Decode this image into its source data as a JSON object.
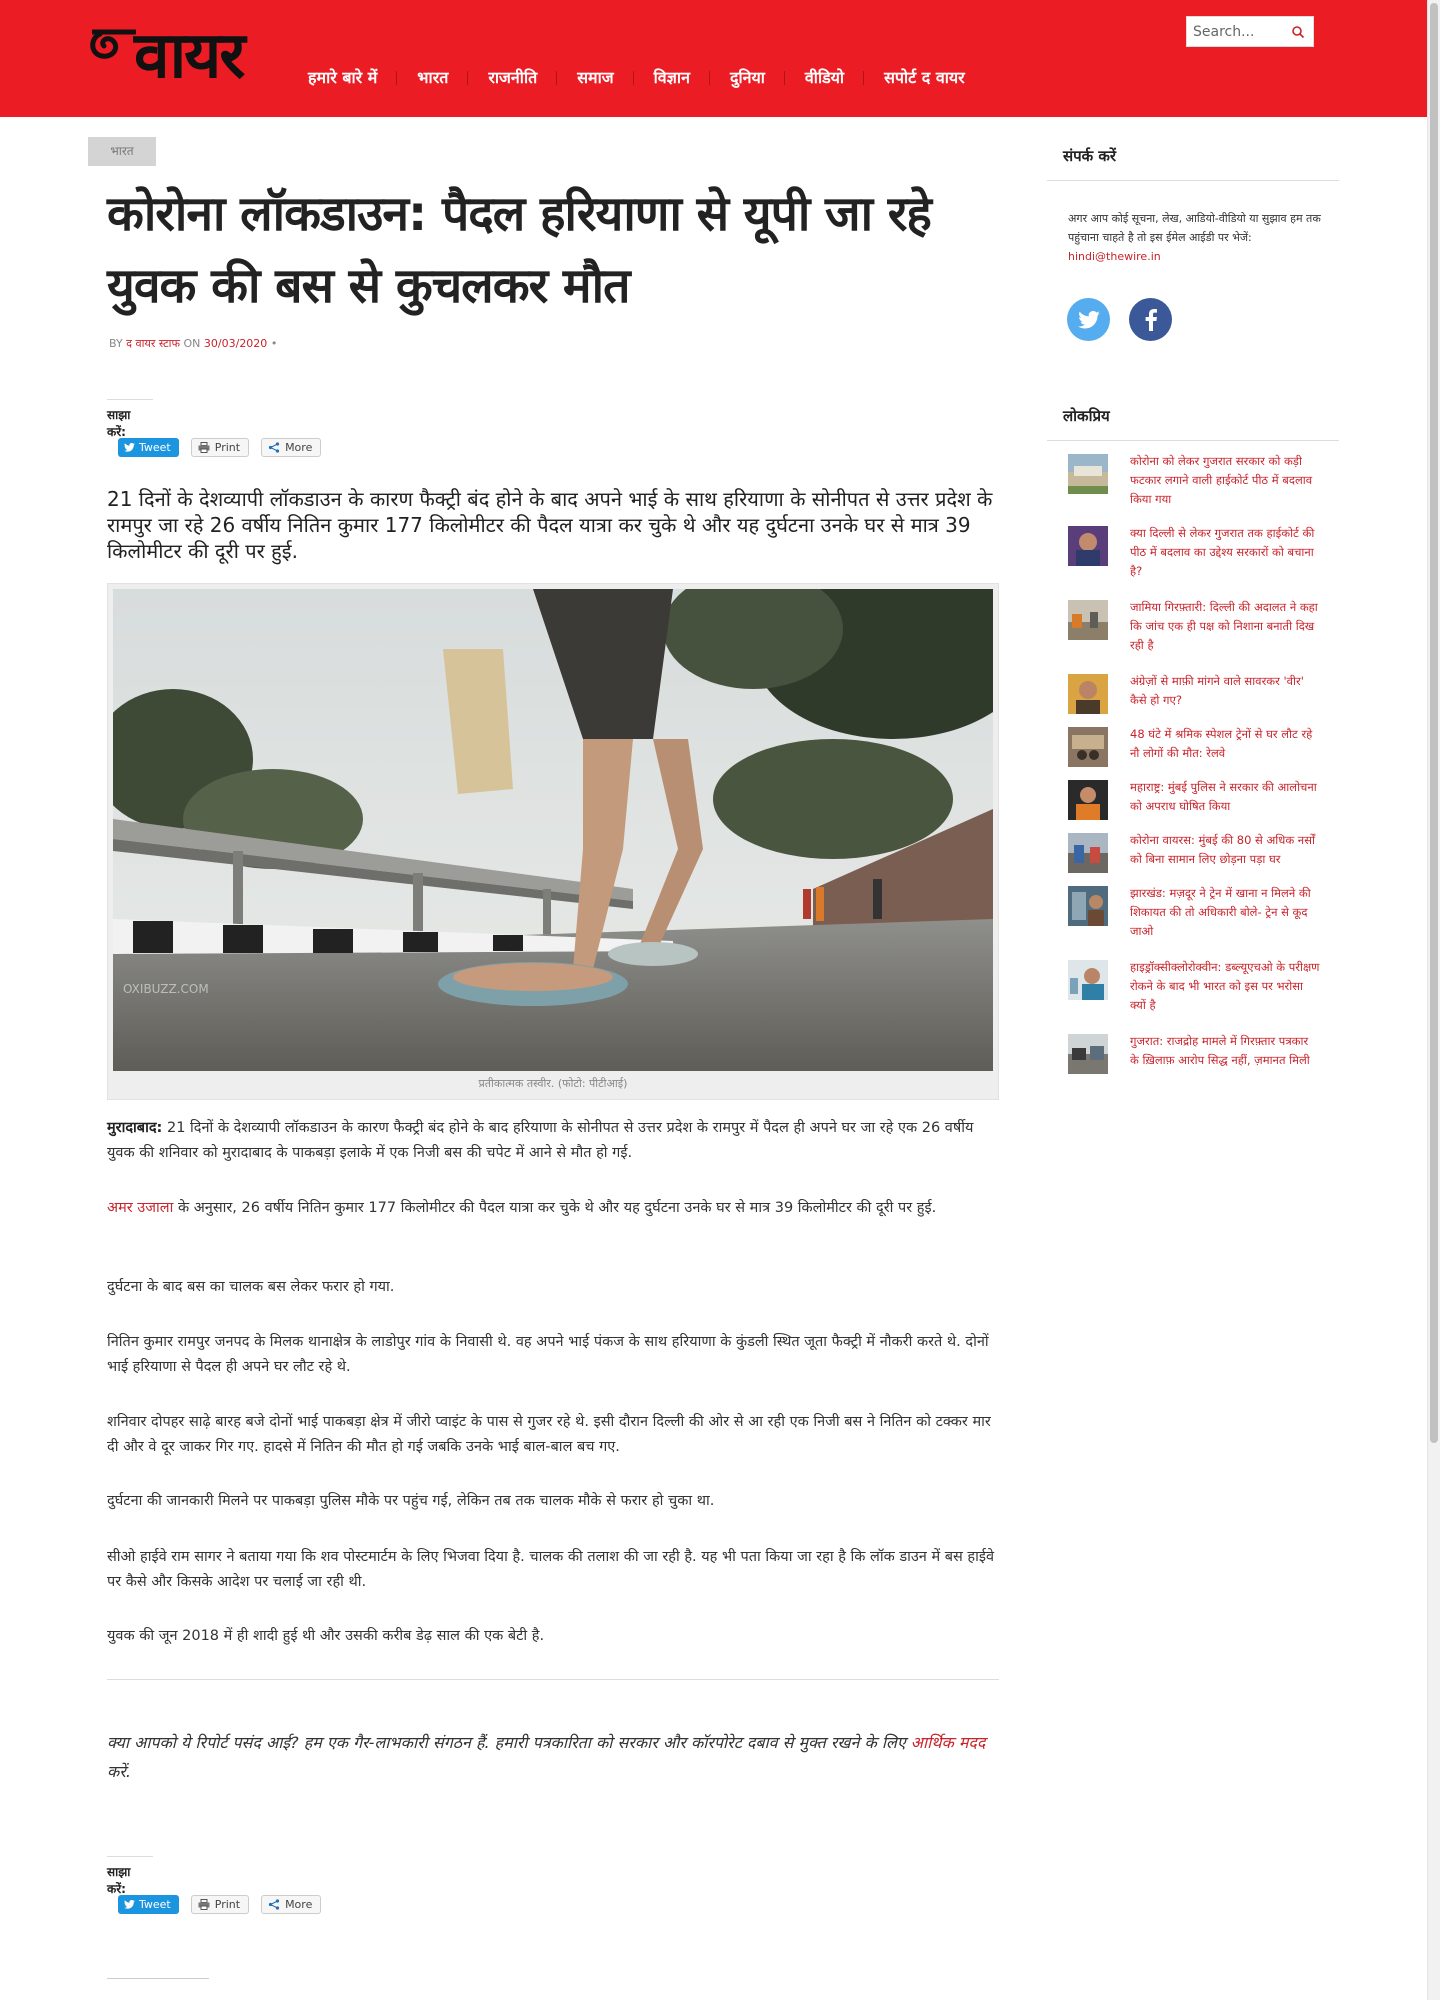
{
  "header": {
    "logo_text": "वायर",
    "nav": [
      "हमारे बारे में",
      "भारत",
      "राजनीति",
      "समाज",
      "विज्ञान",
      "दुनिया",
      "वीडियो",
      "सपोर्ट द वायर"
    ],
    "search_placeholder": "Search..."
  },
  "article": {
    "category": "भारत",
    "title": "कोरोना लॉकडाउन: पैदल हरियाणा से यूपी जा रहे युवक की बस से कुचलकर मौत",
    "byline_by": "BY",
    "byline_author": "द वायर स्टाफ",
    "byline_on": "ON",
    "byline_date": "30/03/2020",
    "byline_dot": "•",
    "share_label": "साझा करें:",
    "share_buttons": {
      "tweet": "Tweet",
      "print": "Print",
      "more": "More"
    },
    "lede": "21 दिनों के देशव्यापी लॉकडाउन के कारण फैक्ट्री बंद होने के बाद अपने भाई के साथ हरियाणा के सोनीपत से उत्तर प्रदेश के रामपुर जा रहे 26 वर्षीय नितिन कुमार 177 किलोमीटर की पैदल यात्रा कर चुके थे और यह दुर्घटना उनके घर से मात्र 39 किलोमीटर की दूरी पर हुई.",
    "photo_watermark": "OXIBUZZ.COM",
    "caption": "प्रतीकात्मक तस्वीर. (फोटो: पीटीआई)",
    "p1_lead": "मुरादाबाद:",
    "p1": " 21 दिनों के देशव्यापी लॉकडाउन के कारण फैक्ट्री बंद होने के बाद हरियाणा के सोनीपत से उत्तर प्रदेश के रामपुर में पैदल ही अपने घर जा रहे एक 26 वर्षीय युवक की शनिवार को मुरादाबाद के पाकबड़ा इलाके में एक निजी बस की चपेट में आने से मौत हो गई.",
    "p2_link": "अमर उजाला",
    "p2": " के अनुसार, 26 वर्षीय नितिन कुमार 177 किलोमीटर की पैदल यात्रा कर चुके थे और यह दुर्घटना उनके घर से मात्र 39 किलोमीटर की दूरी पर हुई.",
    "p3": "दुर्घटना के बाद बस का चालक बस लेकर फरार हो गया.",
    "p4": "नितिन कुमार रामपुर जनपद के मिलक थानाक्षेत्र के लाडोपुर गांव के निवासी थे. वह अपने भाई पंकज के साथ हरियाणा के कुंडली स्थित जूता फैक्ट्री में नौकरी करते थे. दोनों भाई हरियाणा से पैदल ही अपने घर लौट रहे थे.",
    "p5": "शनिवार दोपहर साढ़े बारह बजे दोनों भाई पाकबड़ा क्षेत्र में जीरो प्वाइंट के पास से गुजर रहे थे. इसी दौरान दिल्ली की ओर से आ रही एक निजी बस ने नितिन को टक्कर मार दी और वे दूर जाकर गिर गए. हादसे में नितिन की मौत हो गई जबकि उनके भाई बाल-बाल बच गए.",
    "p6": "दुर्घटना की जानकारी मिलने पर पाकबड़ा पुलिस मौके पर पहुंच गई, लेकिन तब तक चालक मौके से फरार हो चुका था.",
    "p7": "सीओ हाईवे राम सागर ने बताया गया कि शव पोस्टमार्टम के लिए भिजवा दिया है. चालक की तलाश की जा रही है. यह भी पता किया जा रहा है कि लॉक डाउन में बस हाईवे पर कैसे और किसके आदेश पर चलाई जा रही थी.",
    "p8": "युवक की जून 2018 में ही शादी हुई थी और उसकी करीब डेढ़ साल की एक बेटी है.",
    "support_text": "क्या आपको ये रिपोर्ट पसंद आई? हम एक गैर-लाभकारी संगठन हैं. हमारी पत्रकारिता को सरकार और कॉरपोरेट दबाव से मुक्त रखने के लिए ",
    "support_link": "आर्थिक मदद",
    "support_end": " करें."
  },
  "sidebar": {
    "contact_heading": "संपर्क करें",
    "contact_text": "अगर आप कोई सूचना, लेख, आडियो-वीडियो या सुझाव हम तक पहुंचाना चाहते है तो इस ईमेल आईडी पर भेजें:",
    "contact_email": "hindi@thewire.in",
    "popular_heading": "लोकप्रिय",
    "popular": [
      "कोरोना को लेकर गुजरात सरकार को कड़ी फटकार लगाने वाली हाईकोर्ट पीठ में बदलाव किया गया",
      "क्या दिल्ली से लेकर गुजरात तक हाईकोर्ट की पीठ में बदलाव का उद्देश्य सरकारों को बचाना है?",
      "जामिया गिरफ़्तारी: दिल्ली की अदालत ने कहा कि जांच एक ही पक्ष को निशाना बनाती दिख रही है",
      "अंग्रेज़ों से माफ़ी मांगने वाले सावरकर 'वीर' कैसे हो गए?",
      "48 घंटे में श्रमिक स्पेशल ट्रेनों से घर लौट रहे नौ लोगों की मौत: रेलवे",
      "महाराष्ट्र: मुंबई पुलिस ने सरकार की आलोचना को अपराध घोषित किया",
      "कोरोना वायरस: मुंबई की 80 से अधिक नर्सों को बिना सामान लिए छोड़ना पड़ा घर",
      "झारखंड: मज़दूर ने ट्रेन में खाना न मिलने की शिकायत की तो अधिकारी बोले- ट्रेन से कूद जाओ",
      "हाइड्रॉक्सीक्लोरोक्वीन: डब्ल्यूएचओ के परीक्षण रोकने के बाद भी भारत को इस पर भरोसा क्यों है",
      "गुजरात: राजद्रोह मामले में गिरफ़्तार पत्रकार के ख़िलाफ़ आरोप सिद्ध नहीं, ज़मानत मिली"
    ]
  },
  "colors": {
    "brand": "#ec1c24",
    "link": "#c8242b",
    "twitter": "#55acee",
    "facebook": "#3b5998"
  },
  "icons": [
    "search-icon",
    "twitter-icon",
    "facebook-icon",
    "print-icon",
    "share-icon"
  ]
}
